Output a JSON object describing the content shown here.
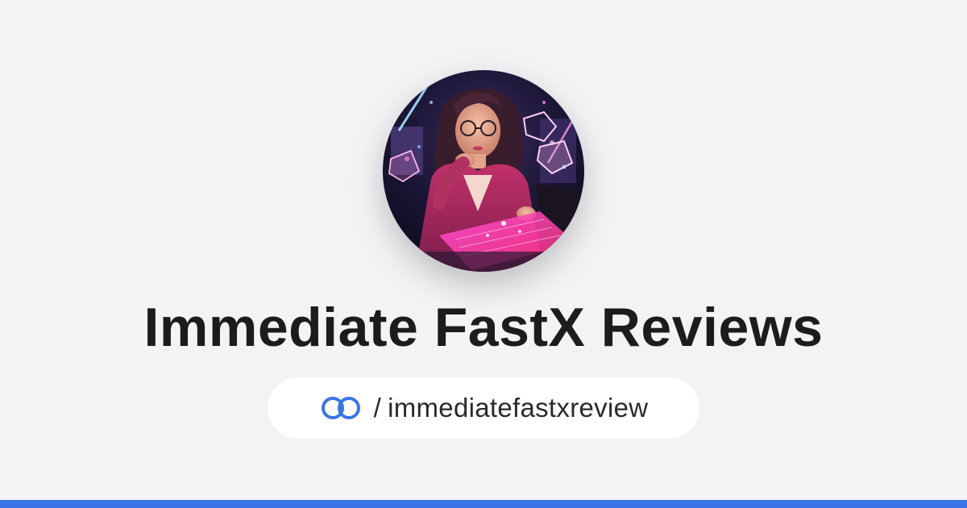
{
  "profile": {
    "title": "Immediate FastX Reviews",
    "handle_separator": "/",
    "handle": "immediatefastxreview",
    "avatar_icon": "profile-avatar-image",
    "link_icon": "link-rings-icon"
  },
  "colors": {
    "background": "#f3f3f6",
    "accent_bar": "#3b74e8",
    "link_icon": "#3b74e8",
    "title_text": "#1c1c1f"
  }
}
